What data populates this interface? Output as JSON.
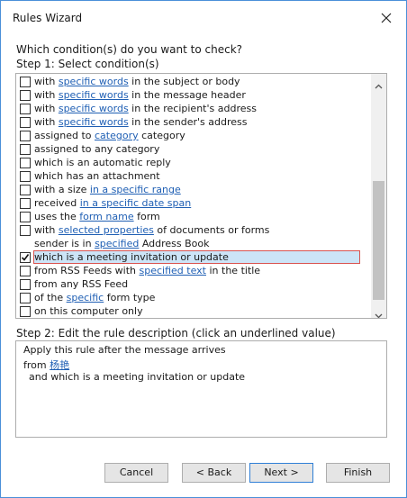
{
  "window": {
    "title": "Rules Wizard",
    "close_icon": "close-icon"
  },
  "prompt": "Which condition(s) do you want to check?",
  "step1_label": "Step 1: Select condition(s)",
  "conditions": [
    {
      "pre": "with ",
      "link": "specific words",
      "post": " in the subject or body",
      "checked": false,
      "has_checkbox": true
    },
    {
      "pre": "with ",
      "link": "specific words",
      "post": " in the message header",
      "checked": false,
      "has_checkbox": true
    },
    {
      "pre": "with ",
      "link": "specific words",
      "post": " in the recipient's address",
      "checked": false,
      "has_checkbox": true
    },
    {
      "pre": "with ",
      "link": "specific words",
      "post": " in the sender's address",
      "checked": false,
      "has_checkbox": true
    },
    {
      "pre": "assigned to ",
      "link": "category",
      "post": " category",
      "checked": false,
      "has_checkbox": true
    },
    {
      "pre": "assigned to any category",
      "link": "",
      "post": "",
      "checked": false,
      "has_checkbox": true
    },
    {
      "pre": "which is an automatic reply",
      "link": "",
      "post": "",
      "checked": false,
      "has_checkbox": true
    },
    {
      "pre": "which has an attachment",
      "link": "",
      "post": "",
      "checked": false,
      "has_checkbox": true
    },
    {
      "pre": "with a size ",
      "link": "in a specific range",
      "post": "",
      "checked": false,
      "has_checkbox": true
    },
    {
      "pre": "received ",
      "link": "in a specific date span",
      "post": "",
      "checked": false,
      "has_checkbox": true
    },
    {
      "pre": "uses the ",
      "link": "form name",
      "post": " form",
      "checked": false,
      "has_checkbox": true
    },
    {
      "pre": "with ",
      "link": "selected properties",
      "post": " of documents or forms",
      "checked": false,
      "has_checkbox": true
    },
    {
      "pre": "sender is in ",
      "link": "specified",
      "post": " Address Book",
      "checked": false,
      "has_checkbox": false
    },
    {
      "pre": "which is a meeting invitation or update",
      "link": "",
      "post": "",
      "checked": true,
      "has_checkbox": true,
      "selected": true
    },
    {
      "pre": "from RSS Feeds with ",
      "link": "specified text",
      "post": " in the title",
      "checked": false,
      "has_checkbox": true
    },
    {
      "pre": "from any RSS Feed",
      "link": "",
      "post": "",
      "checked": false,
      "has_checkbox": true
    },
    {
      "pre": "of the ",
      "link": "specific",
      "post": " form type",
      "checked": false,
      "has_checkbox": true
    },
    {
      "pre": "on this computer only",
      "link": "",
      "post": "",
      "checked": false,
      "has_checkbox": true
    }
  ],
  "scrollbar": {
    "position": 0.9
  },
  "step2_label": "Step 2: Edit the rule description (click an underlined value)",
  "description": {
    "line1": "Apply this rule after the message arrives",
    "line2_pre": "from ",
    "line2_link": "杨艳",
    "line3": "and which is a meeting invitation or update"
  },
  "buttons": {
    "cancel": "Cancel",
    "back": "< Back",
    "next": "Next >",
    "finish": "Finish"
  }
}
